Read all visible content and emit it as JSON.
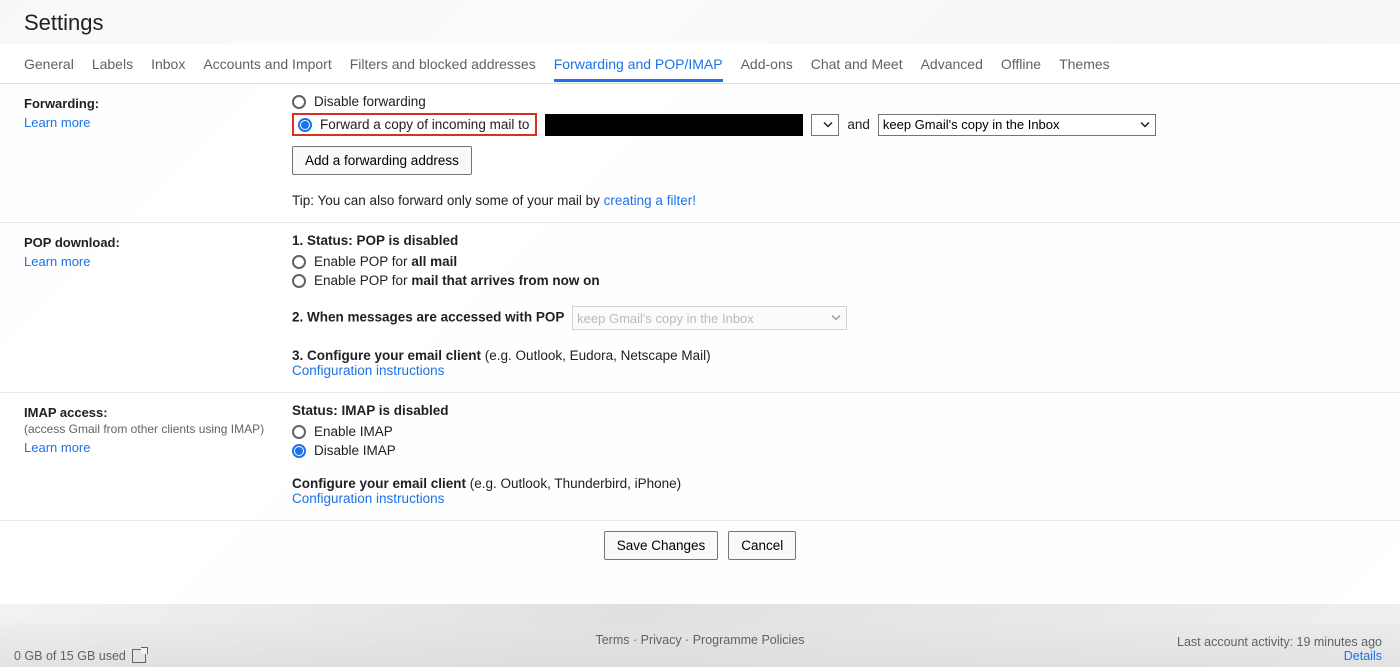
{
  "header": {
    "title": "Settings"
  },
  "tabs": [
    {
      "label": "General",
      "active": false
    },
    {
      "label": "Labels",
      "active": false
    },
    {
      "label": "Inbox",
      "active": false
    },
    {
      "label": "Accounts and Import",
      "active": false
    },
    {
      "label": "Filters and blocked addresses",
      "active": false
    },
    {
      "label": "Forwarding and POP/IMAP",
      "active": true
    },
    {
      "label": "Add-ons",
      "active": false
    },
    {
      "label": "Chat and Meet",
      "active": false
    },
    {
      "label": "Advanced",
      "active": false
    },
    {
      "label": "Offline",
      "active": false
    },
    {
      "label": "Themes",
      "active": false
    }
  ],
  "forwarding": {
    "section_title": "Forwarding:",
    "learn_more": "Learn more",
    "disable_label": "Disable forwarding",
    "forward_label": "Forward a copy of incoming mail to",
    "and_text": "and",
    "action_selected": "keep Gmail's copy in the Inbox",
    "add_btn": "Add a forwarding address",
    "tip_prefix": "Tip: You can also forward only some of your mail by ",
    "tip_link": "creating a filter!"
  },
  "pop": {
    "section_title": "POP download:",
    "learn_more": "Learn more",
    "status_label": "1. Status: ",
    "status_value": "POP is disabled",
    "enable_all_prefix": "Enable POP for ",
    "enable_all_bold": "all mail",
    "enable_now_prefix": "Enable POP for ",
    "enable_now_bold": "mail that arrives from now on",
    "when_accessed": "2. When messages are accessed with POP",
    "when_action": "keep Gmail's copy in the Inbox",
    "configure_label": "3. Configure your email client ",
    "configure_hint": "(e.g. Outlook, Eudora, Netscape Mail)",
    "config_link": "Configuration instructions"
  },
  "imap": {
    "section_title": "IMAP access:",
    "subtext": "(access Gmail from other clients using IMAP)",
    "learn_more": "Learn more",
    "status_label": "Status: ",
    "status_value": "IMAP is disabled",
    "enable_label": "Enable IMAP",
    "disable_label": "Disable IMAP",
    "configure_label": "Configure your email client ",
    "configure_hint": "(e.g. Outlook, Thunderbird, iPhone)",
    "config_link": "Configuration instructions"
  },
  "actions": {
    "save": "Save Changes",
    "cancel": "Cancel"
  },
  "footer": {
    "storage": "0 GB of 15 GB used",
    "terms": "Terms",
    "privacy": "Privacy",
    "policies": "Programme Policies",
    "activity": "Last account activity: 19 minutes ago",
    "details": "Details"
  }
}
